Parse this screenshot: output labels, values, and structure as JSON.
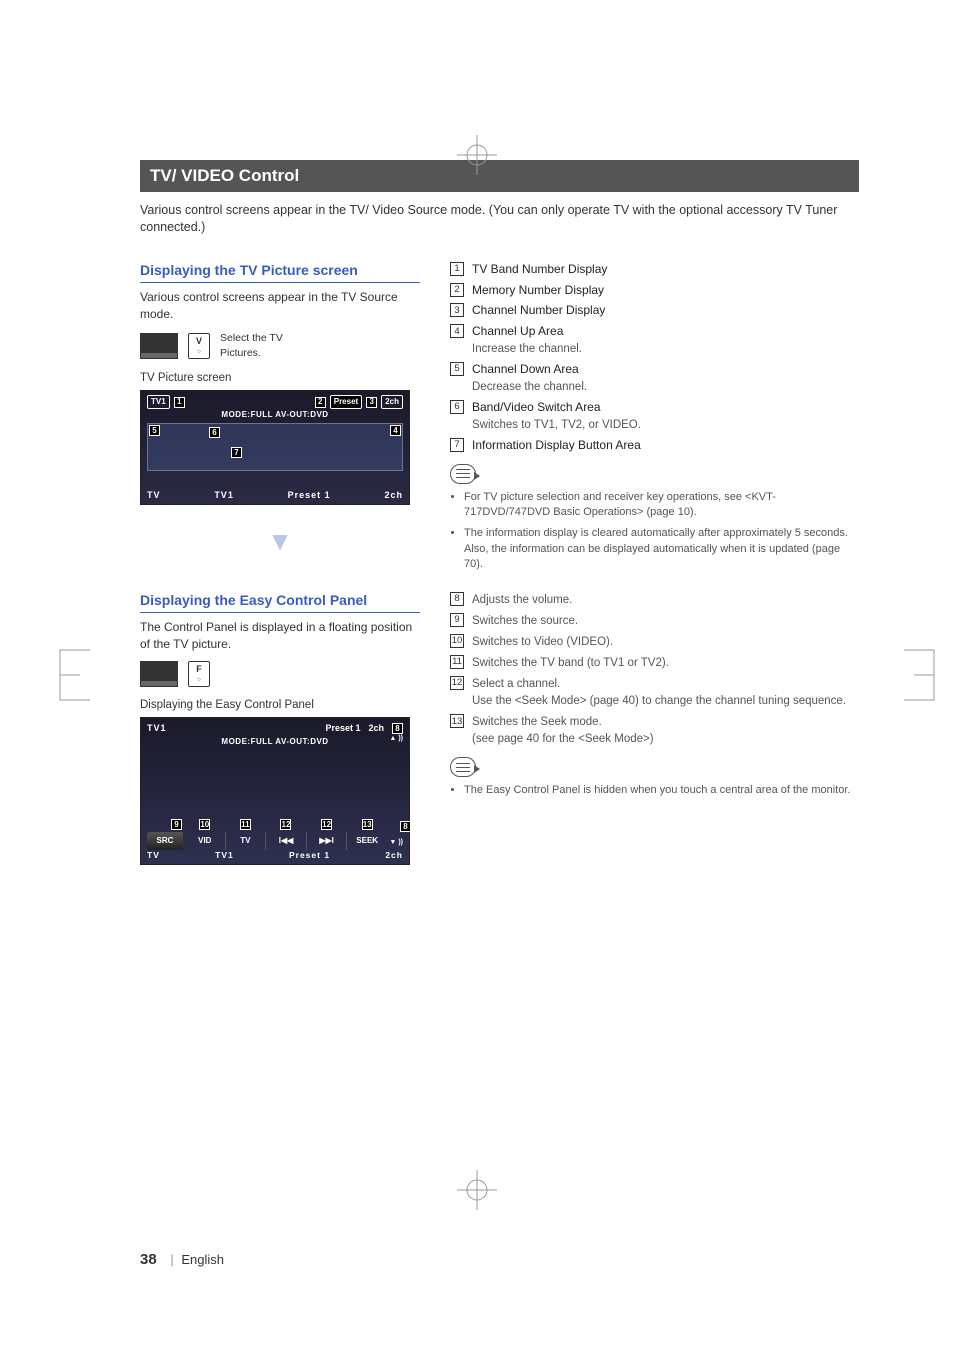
{
  "header": {
    "title": "TV/ VIDEO Control"
  },
  "intro": "Various control screens appear in the TV/ Video Source mode. (You can only operate TV with the optional accessory TV Tuner connected.)",
  "section1": {
    "title": "Displaying the TV Picture screen",
    "desc": "Various control screens appear in the TV Source mode.",
    "step_btn_label": "V",
    "step_text1": "Select the TV",
    "step_text2": "Pictures.",
    "caption": "TV Picture screen",
    "ss": {
      "tv1": "TV1",
      "preset_top": "Preset",
      "ch_top": "2ch",
      "mode_line": "MODE:FULL  AV-OUT:DVD",
      "bottom_tv": "TV",
      "bottom_tv1": "TV1",
      "bottom_preset": "Preset 1",
      "bottom_ch": "2ch"
    }
  },
  "section2": {
    "title": "Displaying the Easy Control Panel",
    "desc": "The Control Panel is displayed in a floating position of the TV picture.",
    "step_btn_label": "F",
    "caption": "Displaying the Easy Control Panel",
    "ss": {
      "top_tv1": "TV1",
      "top_preset": "Preset 1",
      "top_ch": "2ch",
      "mode_line": "MODE:FULL  AV-OUT:DVD",
      "btn_src": "SRC",
      "btn_vid": "VID",
      "btn_tv": "TV",
      "btn_prev": "I◀◀",
      "btn_next": "▶▶I",
      "btn_seek": "SEEK",
      "vol_up": "▲ ))",
      "vol_dn": "▼ ))",
      "bot_tv": "TV",
      "bot_tv1": "TV1",
      "bot_preset": "Preset 1",
      "bot_ch": "2ch"
    }
  },
  "list1": {
    "i1": {
      "t": "TV Band Number Display"
    },
    "i2": {
      "t": "Memory Number Display"
    },
    "i3": {
      "t": "Channel Number Display"
    },
    "i4": {
      "t": "Channel Up Area",
      "s": "Increase the channel."
    },
    "i5": {
      "t": "Channel Down Area",
      "s": "Decrease the channel."
    },
    "i6": {
      "t": "Band/Video Switch Area",
      "s": "Switches to TV1, TV2, or VIDEO."
    },
    "i7": {
      "t": "Information Display Button Area"
    }
  },
  "notes1": {
    "b1": "For TV picture selection and receiver key operations, see <KVT-717DVD/747DVD Basic Operations> (page 10).",
    "b2": "The information display is cleared automatically after approximately 5 seconds. Also, the information can be displayed automatically when it is updated (page 70)."
  },
  "list2": {
    "i8": {
      "t": "Adjusts the volume."
    },
    "i9": {
      "t": "Switches the source."
    },
    "i10": {
      "t": "Switches to Video (VIDEO)."
    },
    "i11": {
      "t": "Switches the TV band (to TV1 or TV2)."
    },
    "i12": {
      "t": "Select a channel.",
      "s": "Use the <Seek Mode> (page 40) to change the channel tuning sequence."
    },
    "i13": {
      "t": "Switches the Seek mode.",
      "s": "(see page 40 for the <Seek Mode>)"
    }
  },
  "notes2": {
    "b1": "The Easy Control Panel is hidden when you touch a central area of the monitor."
  },
  "footer": {
    "page": "38",
    "lang": "English"
  }
}
